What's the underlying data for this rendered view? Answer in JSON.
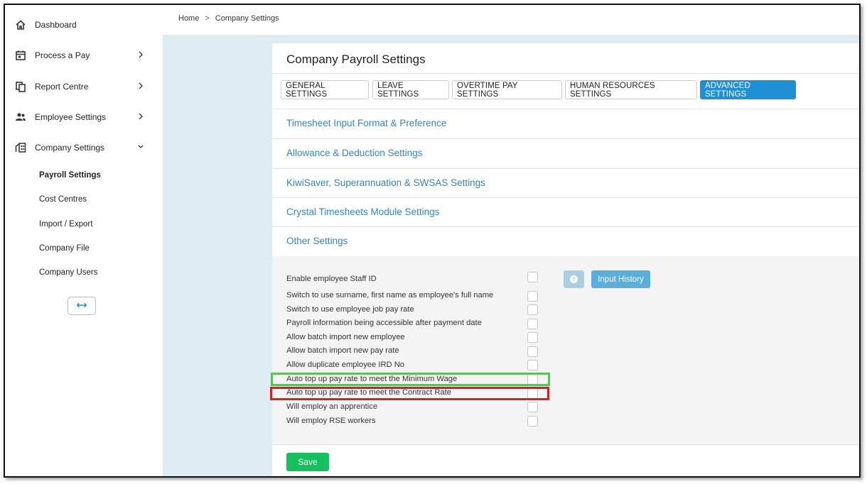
{
  "sidebar": {
    "items": [
      {
        "label": "Dashboard",
        "icon": "home-icon"
      },
      {
        "label": "Process a Pay",
        "icon": "calendar-icon"
      },
      {
        "label": "Report Centre",
        "icon": "document-icon"
      },
      {
        "label": "Employee Settings",
        "icon": "people-icon"
      },
      {
        "label": "Company Settings",
        "icon": "building-icon"
      }
    ],
    "sub_items": [
      "Payroll Settings",
      "Cost Centres",
      "Import / Export",
      "Company File",
      "Company Users"
    ],
    "collapse_icon": "↔"
  },
  "breadcrumb": {
    "home": "Home",
    "separator": ">",
    "current": "Company Settings"
  },
  "card": {
    "title": "Company Payroll Settings",
    "tabs": [
      "GENERAL SETTINGS",
      "LEAVE SETTINGS",
      "OVERTIME PAY SETTINGS",
      "HUMAN RESOURCES SETTINGS",
      "ADVANCED SETTINGS"
    ],
    "active_tab": "ADVANCED SETTINGS",
    "sections": [
      "Timesheet Input Format & Preference",
      "Allowance & Deduction Settings",
      "KiwiSaver, Superannuation & SWSAS Settings",
      "Crystal Timesheets Module Settings",
      "Other Settings"
    ],
    "options": [
      "Enable employee Staff ID",
      "Switch to use surname, first name as employee's full name",
      "Switch to use employee job pay rate",
      "Payroll information being accessible after payment date",
      "Allow batch import new employee",
      "Allow batch import new pay rate",
      "Allow duplicate employee IRD No",
      "Auto top up pay rate to meet the Minimum Wage",
      "Auto top up pay rate to meet the Contract Rate",
      "Will employ an apprentice",
      "Will employ RSE workers"
    ],
    "help_icon": "?",
    "input_history": "Input History",
    "save": "Save"
  },
  "colors": {
    "accent_blue": "#1f8fd6",
    "link_blue": "#2e87c8",
    "save_green": "#17c05f",
    "highlight_green": "#2ee22a",
    "highlight_red": "#d62020",
    "background": "#deedf4"
  }
}
